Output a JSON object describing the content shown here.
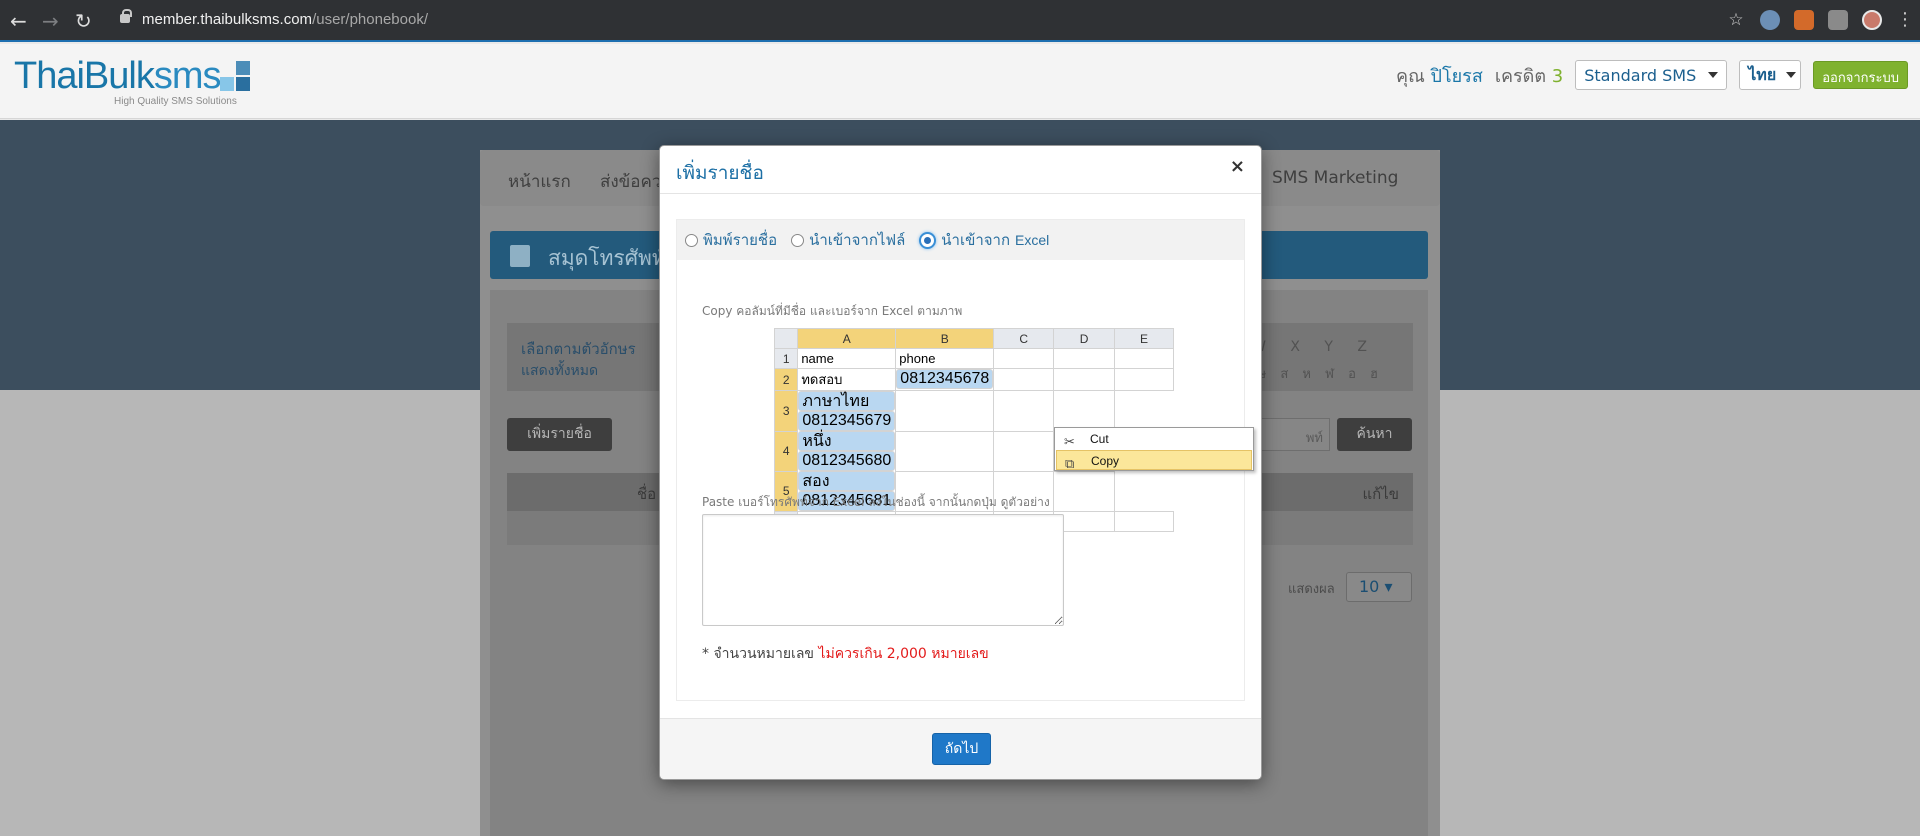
{
  "browser": {
    "url_host": "member.thaibulksms.com",
    "url_path": "/user/phonebook/"
  },
  "header": {
    "logo_text_a": "ThaiBulk",
    "logo_text_b": "sms",
    "logo_tagline": "High Quality SMS Solutions",
    "user_prefix": "คุณ",
    "user_name": "ปิโยรส",
    "credit_label": "เครดิต",
    "credit_value": "3",
    "sms_type": "Standard SMS",
    "language": "ไทย",
    "logout": "ออกจากระบบ"
  },
  "background": {
    "nav_home": "หน้าแรก",
    "nav_send": "ส่งข้อควา",
    "nav_marketing": "SMS Marketing",
    "section_title": "สมุดโทรศัพท์",
    "filter_label": "เลือกตามตัวอักษร",
    "show_all": "แสดงทั้งหมด",
    "letters": "W X Y Z",
    "thai_letters": "ว ศ ษ ส ห ฬ อ ฮ",
    "add_button": "เพิ่มรายชื่อ",
    "search_placeholder": "พท์",
    "search_button": "ค้นหา",
    "col_name": "ชื่อ",
    "col_edit": "แก้ไข",
    "show_label": "แสดงผล",
    "show_value": "10"
  },
  "modal": {
    "title": "เพิ่มรายชื่อ",
    "close": "×",
    "options": [
      {
        "label": "พิมพ์รายชื่อ",
        "checked": false
      },
      {
        "label": "นำเข้าจากไฟล์",
        "checked": false
      },
      {
        "label": "นำเข้าจาก",
        "suffix": "Excel",
        "checked": true
      }
    ],
    "copy_hint": "Copy คอลัมน์ที่มีชื่อ และเบอร์จาก Excel ตามภาพ",
    "excel": {
      "columns": [
        "A",
        "B",
        "C",
        "D",
        "E"
      ],
      "rows": [
        {
          "n": "1",
          "a": "name",
          "b": "phone"
        },
        {
          "n": "2",
          "a": "ทดสอบ",
          "b": "0812345678"
        },
        {
          "n": "3",
          "a": "ภาษาไทย",
          "b": "0812345679"
        },
        {
          "n": "4",
          "a": "หนึ่ง",
          "b": "0812345680"
        },
        {
          "n": "5",
          "a": "สอง",
          "b": "0812345681"
        },
        {
          "n": "6",
          "a": "",
          "b": ""
        }
      ],
      "menu": [
        {
          "label": "Cut",
          "icon": "scissors-icon"
        },
        {
          "label": "Copy",
          "icon": "copy-icon"
        }
      ]
    },
    "paste_hint": "Paste เบอร์โทรศัพท์จาก Excel ลงในช่องนี้ จากนั้นกดปุ่ม ดูตัวอย่าง",
    "paste_value": "",
    "limit_prefix": "* จำนวนหมายเลข",
    "limit_warning": "ไม่ควรเกิน 2,000 หมายเลข",
    "next_button": "ถัดไป"
  },
  "colors": {
    "accent": "#1c6fa5",
    "primary_button": "#1f78c8",
    "logout_green": "#7fb22f",
    "warning_red": "#e31b1b"
  }
}
